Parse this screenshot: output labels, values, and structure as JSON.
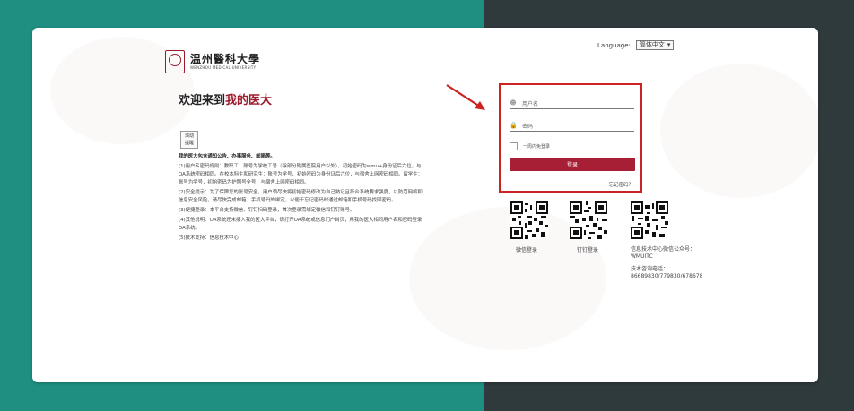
{
  "language": {
    "label": "Language:",
    "selected": "简体中文"
  },
  "logo": {
    "cn": "温州醫科大學",
    "en": "WENZHOU MEDICAL UNIVERSITY"
  },
  "welcome": {
    "prefix": "欢迎来到",
    "highlight": "我的医大"
  },
  "scroll_button": {
    "line1": "滚动",
    "line2": "提醒"
  },
  "notice": {
    "title": "我的医大包含通知公告、办事服务、邮箱等。",
    "items": [
      "(1)用户名密码规则：教职工：账号为学校工号（除部分附属医院用户以外），初始密码为wmu+身份证后六位，与OA系统密码相同。在校本科生和研究生：账号为学号，初始密码为身份证后六位，与宿舍上网密码相同。留学生：账号为学号，初始密码为护照号全号，与宿舍上网密码相同。",
      "(2)安全提示：为了保障您的账号安全，用户须尽快将初始密码修改为自己熟记且符合系统要求强度，以防范网络和信息安全风险，请尽快完成邮箱、手机号码的绑定，以便于忘记密码时通过邮箱和手机号码找回密码。",
      "(3)便捷登录：本平台支持微信、钉钉扫码登录，首次登录需绑定微信和钉钉账号。",
      "(4)其他说明：OA系统还未接入我的医大平台，请打开OA系统或信息门户首页，用我的医大相同用户名和密码登录OA系统。",
      "(5)技术支持：信息技术中心"
    ]
  },
  "login": {
    "username_placeholder": "用户名",
    "password_placeholder": "密码",
    "remember_label": "一周内免登录",
    "login_button": "登录",
    "forgot": "忘记密码？"
  },
  "qr": {
    "wechat_label": "微信登录",
    "dingtalk_label": "钉钉登录"
  },
  "info": {
    "wechat_account": "信息技术中心微信公众号：WMUITC",
    "hotline_label": "技术咨询电话：",
    "hotline": "86689830/779830/678678"
  },
  "colors": {
    "accent": "#a71f34",
    "highlight_box": "#cc2222",
    "teal": "#1f8f82",
    "dark": "#2f3a3d"
  }
}
